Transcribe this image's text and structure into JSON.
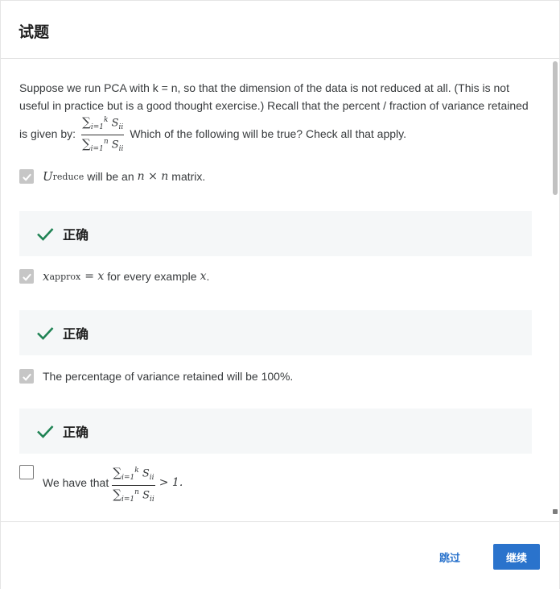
{
  "header": {
    "title": "试题"
  },
  "question": {
    "text_part1": "Suppose we run PCA with k = n, so that the dimension of the data is not reduced at all. (This is not useful in practice but is a good thought exercise.) Recall that the percent / fraction of variance retained is given by:",
    "text_part2": "Which of the following will be true? Check all that apply.",
    "formula": {
      "sum_symbol": "∑",
      "num_upper": "k",
      "den_upper": "n",
      "lower": "i=1",
      "term": "S",
      "term_sub": "ii"
    }
  },
  "options": [
    {
      "math_prefix": "U",
      "math_prefix_sub": "reduce",
      "text": "will be an",
      "math_suffix": "n × n",
      "text_end": "matrix.",
      "checked": true,
      "feedback": "正确"
    },
    {
      "math_prefix": "x",
      "math_prefix_sub": "approx",
      "math_mid": "= x",
      "text": "for every example",
      "math_suffix": "x",
      "text_end": ".",
      "checked": true,
      "feedback": "正确"
    },
    {
      "text": "The percentage of variance retained will be 100%.",
      "checked": true,
      "feedback": "正确"
    },
    {
      "text": "We have that",
      "math_suffix": "> 1.",
      "checked": false
    }
  ],
  "footer": {
    "skip_label": "跳过",
    "continue_label": "继续"
  },
  "colors": {
    "accent": "#2a73cc",
    "correct_green": "#1f8354",
    "feedback_bg": "#f5f7f8",
    "checkbox_checked": "#c6c6c6"
  },
  "icons": {
    "checkbox_checked": "checkbox-checked-icon",
    "checkbox_unchecked": "checkbox-unchecked-icon",
    "correct": "checkmark-icon"
  }
}
